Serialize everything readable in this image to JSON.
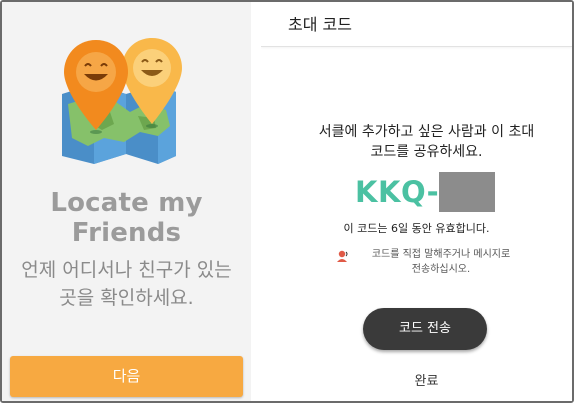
{
  "left": {
    "app_title": "Locate my Friends",
    "subtitle_line1": "언제 어디서나 친구가 있는",
    "subtitle_line2": "곳을 확인하세요.",
    "next_button": "다음",
    "accent_color": "#f7a941"
  },
  "right": {
    "header_title": "초대 코드",
    "description_line1": "서클에 추가하고 싶은 사람과 이 초대",
    "description_line2": "코드를 공유하세요.",
    "code_visible": "KKQ-",
    "validity": "이 코드는 6일 동안 유효합니다.",
    "hint_line1": "코드를 직접 말해주거나 메시지로",
    "hint_line2": "전송하십시오.",
    "send_button": "코드 전송",
    "done_link": "완료",
    "code_color": "#4bc1a2"
  }
}
